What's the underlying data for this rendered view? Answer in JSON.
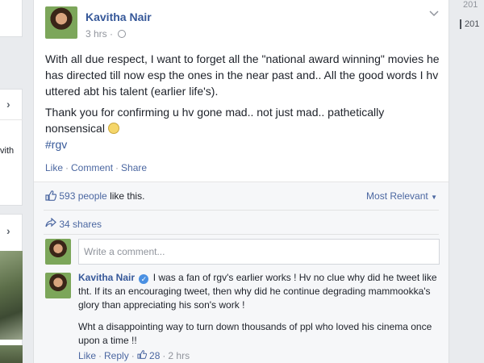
{
  "left": {
    "partial_text": "vith"
  },
  "post": {
    "author": "Kavitha Nair",
    "time": "3 hrs",
    "dot": "·",
    "paragraph1": "With all due respect, I want to forget all the \"national award winning\" movies he has directed till now esp the ones in the near past and.. All the good words I hv uttered abt his talent (earlier life's).",
    "paragraph2": "Thank you for confirming u hv gone mad.. not just mad.. pathetically nonsensical",
    "hashtag": "#rgv",
    "actions": {
      "like": "Like",
      "comment": "Comment",
      "share": "Share",
      "sep": "·"
    }
  },
  "ufi": {
    "likes_count": "593 people",
    "likes_suffix": " like this.",
    "sort": "Most Relevant",
    "shares": "34 shares",
    "comment_placeholder": "Write a comment..."
  },
  "comment": {
    "author": "Kavitha Nair",
    "text1": "I was a fan of rgv's earlier works ! Hv no clue why did he tweet like tht. If its an encouraging tweet, then why did he continue degrading mammookka's glory than appreciating his son's work !",
    "text2": "Wht a disappointing way to turn down thousands of ppl who loved his cinema once upon a time !!",
    "like": "Like",
    "reply": "Reply",
    "likes": "28",
    "time": "2 hrs",
    "sep": "·"
  },
  "years": [
    "201",
    "201"
  ],
  "colors": {
    "link": "#365899",
    "bg": "#e9ebee",
    "meta": "#90949c"
  },
  "icons": [
    "chevron-right-icon",
    "globe-icon",
    "chevron-down-icon",
    "thumbs-up-icon",
    "share-arrow-icon",
    "verified-badge-icon",
    "smiley-emoji-icon"
  ]
}
